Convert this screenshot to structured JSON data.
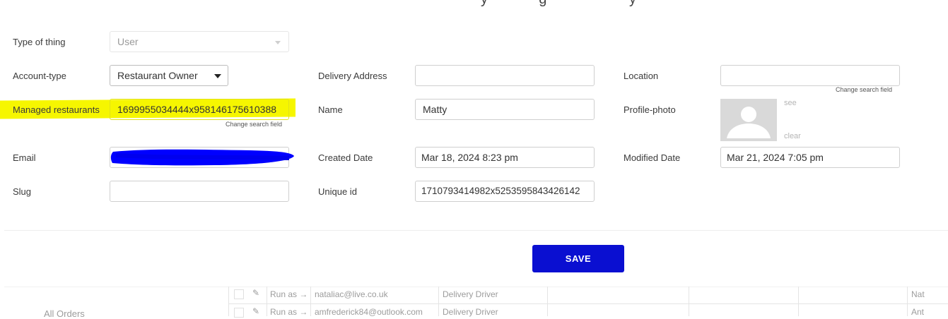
{
  "header": {
    "title_fragment": "y             g                     y"
  },
  "form": {
    "type_of_thing": {
      "label": "Type of thing",
      "value": "User"
    },
    "account_type": {
      "label": "Account-type",
      "value": "Restaurant Owner"
    },
    "delivery_address": {
      "label": "Delivery Address",
      "value": ""
    },
    "location": {
      "label": "Location",
      "value": "",
      "hint": "Change search field"
    },
    "managed_restaurants": {
      "label": "Managed restaurants",
      "value": "1699955034444x958146175610388",
      "hint": "Change search field"
    },
    "name": {
      "label": "Name",
      "value": "Matty"
    },
    "profile_photo": {
      "label": "Profile-photo",
      "see": "see",
      "clear": "clear"
    },
    "email": {
      "label": "Email",
      "value": ""
    },
    "created_date": {
      "label": "Created Date",
      "value": "Mar 18, 2024 8:23 pm"
    },
    "modified_date": {
      "label": "Modified Date",
      "value": "Mar 21, 2024 7:05 pm"
    },
    "slug": {
      "label": "Slug",
      "value": ""
    },
    "unique_id": {
      "label": "Unique id",
      "value": "1710793414982x5253595843426142"
    },
    "save_label": "SAVE"
  },
  "background_table": {
    "sidebar_item": "All Orders",
    "rows": [
      {
        "run_as": "Run as →",
        "email": "nataliac@live.co.uk",
        "role": "Delivery Driver",
        "last": "Nat"
      },
      {
        "run_as": "Run as →",
        "email": "amfrederick84@outlook.com",
        "role": "Delivery Driver",
        "last": "Ant"
      }
    ]
  },
  "colors": {
    "highlight": "#f6f600",
    "save_button": "#0a0fd1",
    "redaction": "#0000ff"
  }
}
